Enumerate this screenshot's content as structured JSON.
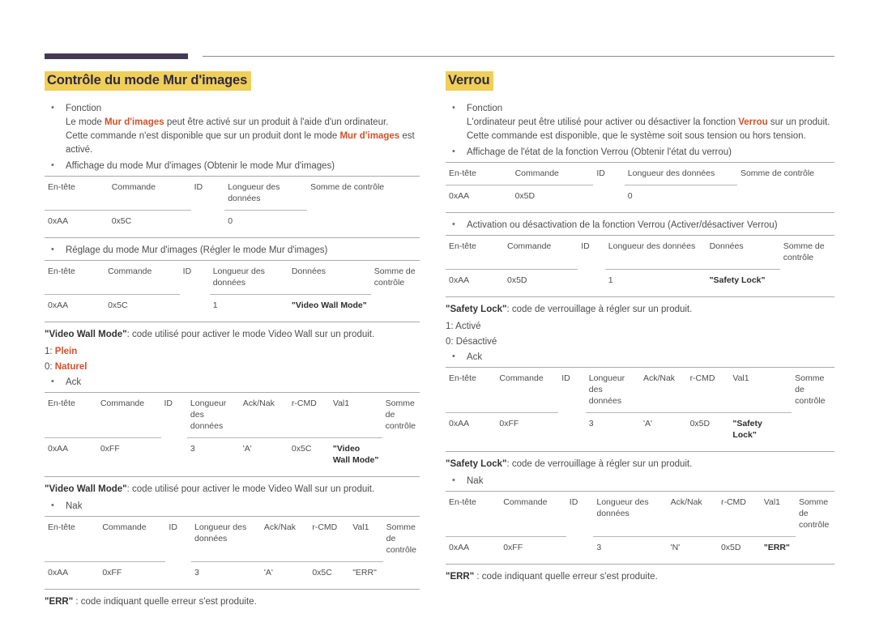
{
  "header": {
    "bar_color": "#453a55",
    "rule_color": "#8a8a8a"
  },
  "accent": {
    "title_highlight": "#f0cf58",
    "title_text": "#2f2a44",
    "orange": "#d4502a"
  },
  "left": {
    "title": "Contrôle du mode Mur d'images",
    "fonction_label": "Fonction",
    "fonction_line1_a": "Le mode ",
    "fonction_line1_b": "Mur d'images",
    "fonction_line1_c": " peut être activé sur un produit à l'aide d'un ordinateur.",
    "fonction_line2_a": "Cette commande n'est disponible que sur un produit dont le mode ",
    "fonction_line2_b": "Mur d'images",
    "fonction_line2_c": " est activé.",
    "get_label": "Affichage du mode Mur d'images (Obtenir le mode Mur d'images)",
    "get_table": {
      "headers": [
        "En-tête",
        "Commande",
        "ID",
        "Longueur des données",
        "Somme de contrôle"
      ],
      "row": [
        "0xAA",
        "0x5C",
        "",
        "0",
        ""
      ]
    },
    "set_label": "Réglage du mode Mur d'images (Régler le mode Mur d'images)",
    "set_table": {
      "headers": [
        "En-tête",
        "Commande",
        "ID",
        "Longueur des données",
        "Données",
        "Somme de contrôle"
      ],
      "row": [
        "0xAA",
        "0x5C",
        "",
        "1",
        "\"Video Wall Mode\"",
        ""
      ]
    },
    "vwm_note_bold": "\"Video Wall Mode\"",
    "vwm_note_rest": ": code utilisé pour activer le mode Video Wall sur un produit.",
    "value_1_prefix": "1: ",
    "value_1": "Plein",
    "value_0_prefix": "0: ",
    "value_0": "Naturel",
    "ack_label": "Ack",
    "ack_table": {
      "headers": [
        "En-tête",
        "Commande",
        "ID",
        "Longueur des données",
        "Ack/Nak",
        "r-CMD",
        "Val1",
        "Somme de contrôle"
      ],
      "row": [
        "0xAA",
        "0xFF",
        "",
        "3",
        "'A'",
        "0x5C",
        "\"Video Wall Mode\"",
        ""
      ]
    },
    "vwm_note2_bold": "\"Video Wall Mode\"",
    "vwm_note2_rest": ": code utilisé pour activer le mode Video Wall sur un produit.",
    "nak_label": "Nak",
    "nak_table": {
      "headers": [
        "En-tête",
        "Commande",
        "ID",
        "Longueur des données",
        "Ack/Nak",
        "r-CMD",
        "Val1",
        "Somme de contrôle"
      ],
      "row": [
        "0xAA",
        "0xFF",
        "",
        "3",
        "'A'",
        "0x5C",
        "\"ERR\"",
        ""
      ]
    },
    "err_note_bold": "\"ERR\"",
    "err_note_rest": " : code indiquant quelle erreur s'est produite."
  },
  "right": {
    "title": "Verrou",
    "fonction_label": "Fonction",
    "fonction_line1_a": "L'ordinateur peut être utilisé pour activer ou désactiver la fonction ",
    "fonction_line1_b": "Verrou",
    "fonction_line1_c": " sur un produit.",
    "fonction_line2": "Cette commande est disponible, que le système soit sous tension ou hors tension.",
    "get_label": "Affichage de l'état de la fonction Verrou (Obtenir l'état du verrou)",
    "get_table": {
      "headers": [
        "En-tête",
        "Commande",
        "ID",
        "Longueur des données",
        "Somme de contrôle"
      ],
      "row": [
        "0xAA",
        "0x5D",
        "",
        "0",
        ""
      ]
    },
    "set_label": "Activation ou désactivation de la fonction Verrou (Activer/désactiver Verrou)",
    "set_table": {
      "headers": [
        "En-tête",
        "Commande",
        "ID",
        "Longueur des données",
        "Données",
        "Somme de contrôle"
      ],
      "row": [
        "0xAA",
        "0x5D",
        "",
        "1",
        "\"Safety Lock\"",
        ""
      ]
    },
    "sl_note_bold": "\"Safety Lock\"",
    "sl_note_rest": ": code de verrouillage à régler sur un produit.",
    "value_1": "1: Activé",
    "value_0": "0: Désactivé",
    "ack_label": "Ack",
    "ack_table": {
      "headers": [
        "En-tête",
        "Commande",
        "ID",
        "Longueur des données",
        "Ack/Nak",
        "r-CMD",
        "Val1",
        "Somme de contrôle"
      ],
      "row": [
        "0xAA",
        "0xFF",
        "",
        "3",
        "'A'",
        "0x5D",
        "\"Safety Lock\"",
        ""
      ]
    },
    "sl_note2_bold": "\"Safety Lock\"",
    "sl_note2_rest": ": code de verrouillage à régler sur un produit.",
    "nak_label": "Nak",
    "nak_table": {
      "headers": [
        "En-tête",
        "Commande",
        "ID",
        "Longueur des données",
        "Ack/Nak",
        "r-CMD",
        "Val1",
        "Somme de contrôle"
      ],
      "row": [
        "0xAA",
        "0xFF",
        "",
        "3",
        "'N'",
        "0x5D",
        "\"ERR\"",
        ""
      ]
    },
    "err_note_bold": "\"ERR\"",
    "err_note_rest": " : code indiquant quelle erreur s'est produite."
  }
}
